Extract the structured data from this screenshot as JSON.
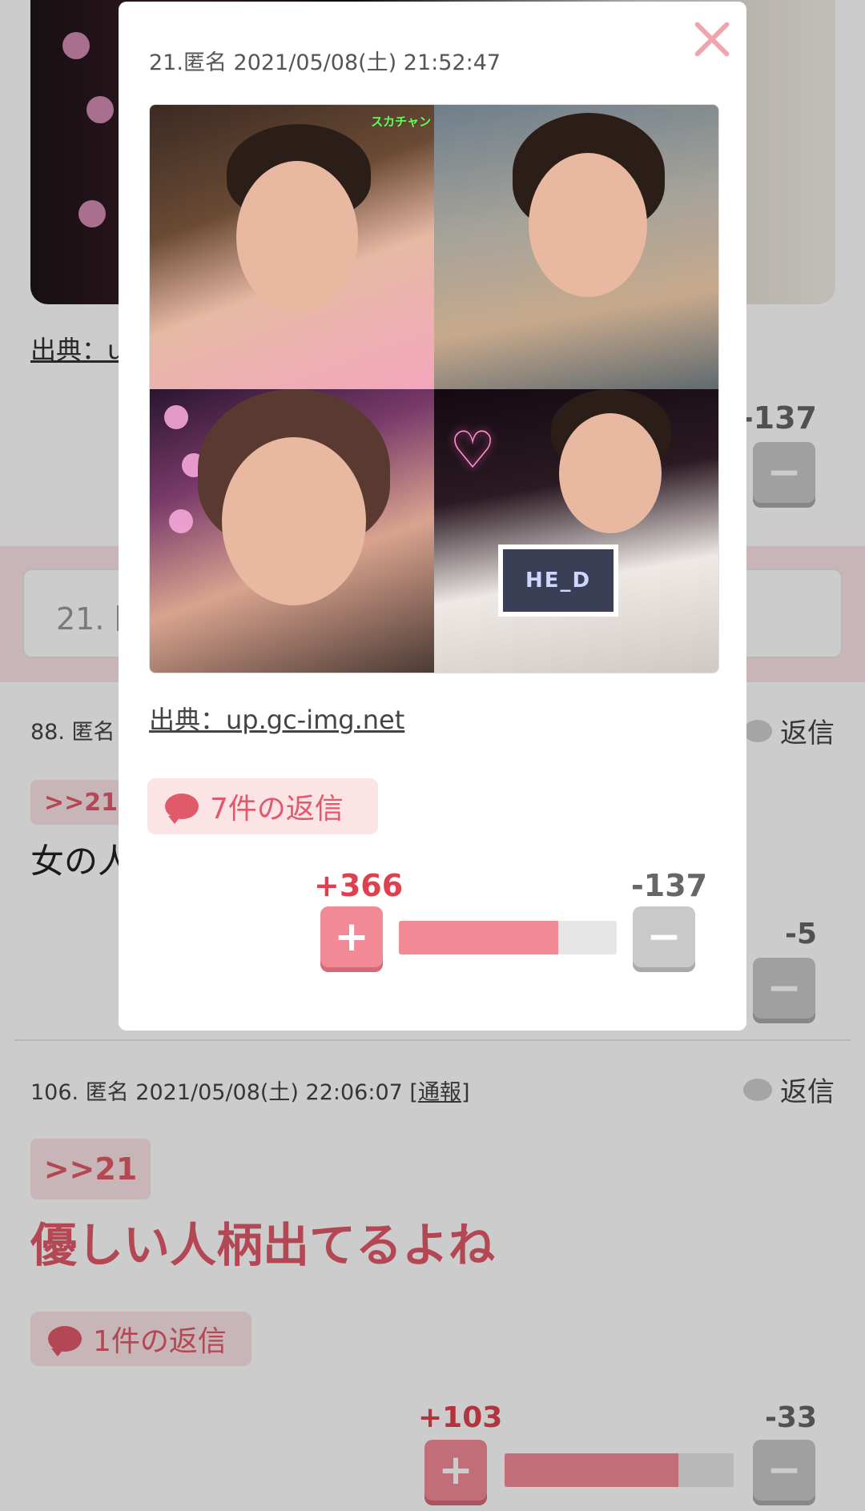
{
  "background": {
    "source_label": "出典：u",
    "first_minus_count": "-137",
    "input_placeholder": "21. 匿",
    "comment_88": {
      "meta": "88. 匿名",
      "reply_label": "返信",
      "anchor": ">>21",
      "text": "女の人",
      "minus_count": "-5"
    },
    "comment_106": {
      "meta_prefix": "106. 匿名 2021/05/08(土) 22:06:07 [",
      "report_label": "通報",
      "meta_suffix": "]",
      "reply_label": "返信",
      "anchor": ">>21",
      "text": "優しい人柄出てるよね",
      "replies_label": "1件の返信",
      "plus_count": "+103",
      "minus_count": "-33",
      "plus_ratio": 0.76
    }
  },
  "modal": {
    "meta": "21.匿名 2021/05/08(土) 21:52:47",
    "image_overlay_text": "スカチャン",
    "card_text": "HE_D",
    "source_label": "出典：up.gc-img.net",
    "replies_label": "7件の返信",
    "plus_count": "+366",
    "minus_count": "-137",
    "plus_ratio": 0.73,
    "plus_symbol": "+",
    "minus_symbol": "−"
  },
  "colors": {
    "accent_pink": "#f28a96",
    "plus_text_red": "#e0404e",
    "close_pink": "#f0a4ad"
  }
}
